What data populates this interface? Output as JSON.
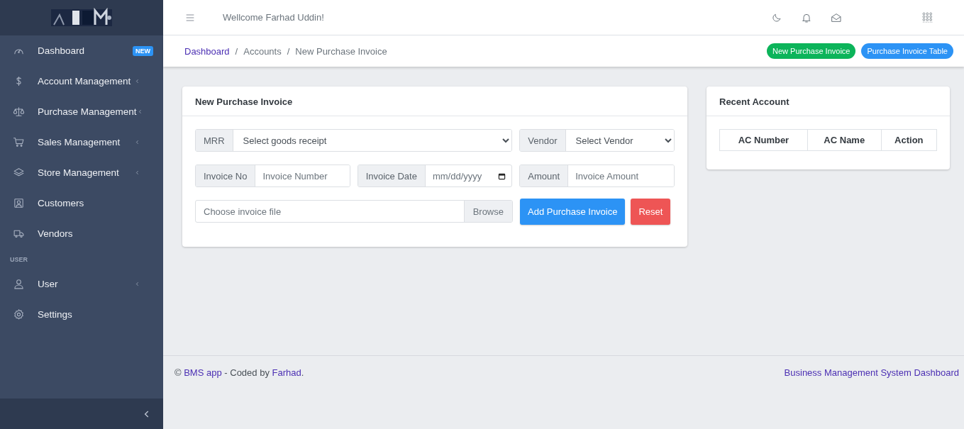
{
  "sidebar": {
    "items": [
      {
        "kind": "link",
        "label": "Dashboard",
        "badge": "NEW",
        "has_submenu": false
      },
      {
        "kind": "link",
        "label": "Account Management",
        "has_submenu": true
      },
      {
        "kind": "link",
        "label": "Purchase Management",
        "has_submenu": true
      },
      {
        "kind": "link",
        "label": "Sales Management",
        "has_submenu": true
      },
      {
        "kind": "link",
        "label": "Store Management",
        "has_submenu": true
      },
      {
        "kind": "link",
        "label": "Customers",
        "has_submenu": false
      },
      {
        "kind": "link",
        "label": "Vendors",
        "has_submenu": false
      },
      {
        "kind": "section",
        "label": "USER"
      },
      {
        "kind": "link",
        "label": "User",
        "has_submenu": true
      },
      {
        "kind": "link",
        "label": "Settings",
        "has_submenu": false
      }
    ]
  },
  "topbar": {
    "welcome": "Wellcome Farhad Uddin!"
  },
  "breadcrumb": [
    {
      "label": "Dashboard",
      "link": true
    },
    {
      "label": "Accounts",
      "link": false,
      "separator": "/"
    },
    {
      "label": "New Purchase Invoice",
      "link": false,
      "separator": "/"
    }
  ],
  "header_buttons": [
    {
      "label": "New Purchase Invoice",
      "color": "#0cb45a"
    },
    {
      "label": "Purchase Invoice Table",
      "color": "#2c93f5"
    }
  ],
  "invoice_form": {
    "title": "New Purchase Invoice",
    "mrr": {
      "label": "MRR",
      "value": "Select goods receipt"
    },
    "vendor": {
      "label": "Vendor",
      "value": "Select Vendor"
    },
    "invoice_no": {
      "label": "Invoice No",
      "placeholder": "Invoice Number"
    },
    "invoice_date": {
      "label": "Invoice Date",
      "placeholder": "mm/dd/yyyy"
    },
    "amount": {
      "label": "Amount",
      "placeholder": "Invoice Amount"
    },
    "file": {
      "placeholder": "Choose invoice file",
      "button": "Browse"
    },
    "submit": "Add Purchase Invoice",
    "reset": "Reset"
  },
  "recent_account": {
    "title": "Recent Account",
    "table": {
      "columns": [
        "AC Number",
        "AC Name",
        "Action"
      ]
    }
  },
  "footer": {
    "prefix": "©",
    "app_link": "BMS app",
    "middle": "- Coded by",
    "author_link": "Farhad",
    "suffix": ".",
    "right_link": "Business Management System Dashboard"
  }
}
